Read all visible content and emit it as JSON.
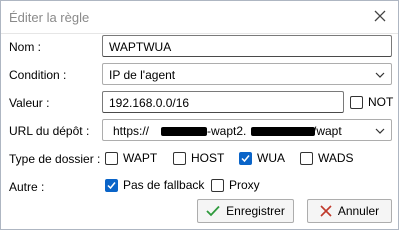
{
  "dialog": {
    "title": "Éditer la règle",
    "close_icon": "close-icon"
  },
  "form": {
    "name": {
      "label": "Nom :",
      "value": "WAPTWUA"
    },
    "condition": {
      "label": "Condition :",
      "value": "IP de l'agent"
    },
    "value": {
      "label": "Valeur :",
      "value": "192.168.0.0/16",
      "not_label": "NOT",
      "not_checked": false
    },
    "depot": {
      "label": "URL du dépôt :",
      "value_prefix": "https://",
      "value_mid": "-wapt2.",
      "value_suffix": "/wapt"
    },
    "folder_type": {
      "label": "Type de dossier :",
      "options": [
        {
          "label": "WAPT",
          "checked": false
        },
        {
          "label": "HOST",
          "checked": false
        },
        {
          "label": "WUA",
          "checked": true
        },
        {
          "label": "WADS",
          "checked": false
        }
      ]
    },
    "other": {
      "label": "Autre :",
      "options": [
        {
          "label": "Pas de fallback",
          "checked": true
        },
        {
          "label": "Proxy",
          "checked": false
        }
      ]
    }
  },
  "buttons": {
    "save": "Enregistrer",
    "cancel": "Annuler"
  },
  "colors": {
    "accent": "#0a64c8",
    "save_icon": "#2e9a3c",
    "cancel_icon": "#c0392b"
  }
}
